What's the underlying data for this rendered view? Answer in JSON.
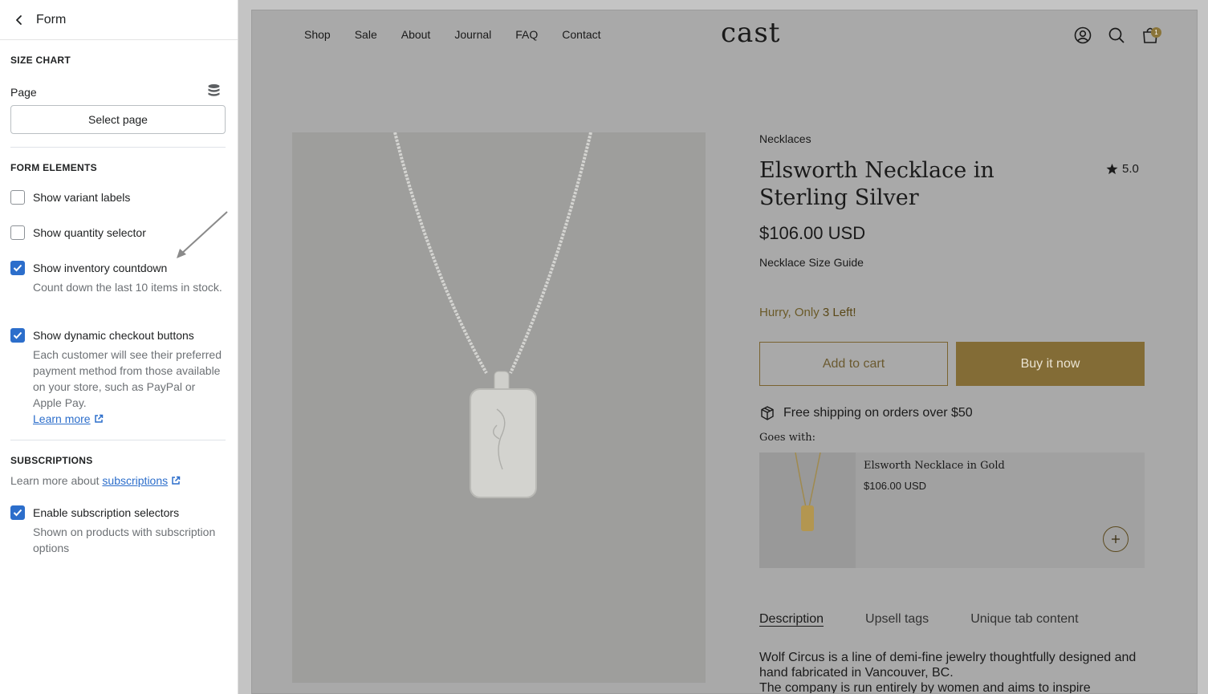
{
  "panel": {
    "title": "Form",
    "size_chart": {
      "heading": "SIZE CHART",
      "page_label": "Page",
      "select_button": "Select page"
    },
    "form_elements": {
      "heading": "FORM ELEMENTS",
      "items": [
        {
          "label": "Show variant labels",
          "checked": false
        },
        {
          "label": "Show quantity selector",
          "checked": false
        },
        {
          "label": "Show inventory countdown",
          "checked": true,
          "help": "Count down the last 10 items in stock."
        },
        {
          "label": "Show dynamic checkout buttons",
          "checked": true,
          "help": "Each customer will see their preferred payment method from those available on your store, such as PayPal or Apple Pay.",
          "link": "Learn more"
        }
      ]
    },
    "subscriptions": {
      "heading": "SUBSCRIPTIONS",
      "learn_prefix": "Learn more about",
      "learn_link": "subscriptions",
      "items": [
        {
          "label": "Enable subscription selectors",
          "checked": true,
          "help": "Shown on products with subscription options"
        }
      ]
    }
  },
  "store": {
    "logo": "cast",
    "nav": [
      "Shop",
      "Sale",
      "About",
      "Journal",
      "FAQ",
      "Contact"
    ],
    "cart_count": "1",
    "product": {
      "category": "Necklaces",
      "title": "Elsworth Necklace in Sterling Silver",
      "rating": "5.0",
      "price": "$106.00 USD",
      "size_guide": "Necklace Size Guide",
      "hurry_prefix": "Hurry, Only",
      "hurry_count": "3 Left!",
      "add_to_cart": "Add to cart",
      "buy_now": "Buy it now",
      "shipping": "Free shipping on orders over $50",
      "goes_with": "Goes with:",
      "upsell": {
        "name": "Elsworth Necklace in Gold",
        "price": "$106.00 USD"
      },
      "tabs": [
        "Description",
        "Upsell tags",
        "Unique tab content"
      ],
      "description": "Wolf Circus is a line of demi-fine jewelry thoughtfully designed and hand fabricated in Vancouver, BC.",
      "description_2": "The company is run entirely by women and aims to inspire"
    }
  },
  "colors": {
    "checkbox_checked": "#2c6ecb",
    "buy_button": "#836c36",
    "hurry_text": "#6b5a28"
  }
}
